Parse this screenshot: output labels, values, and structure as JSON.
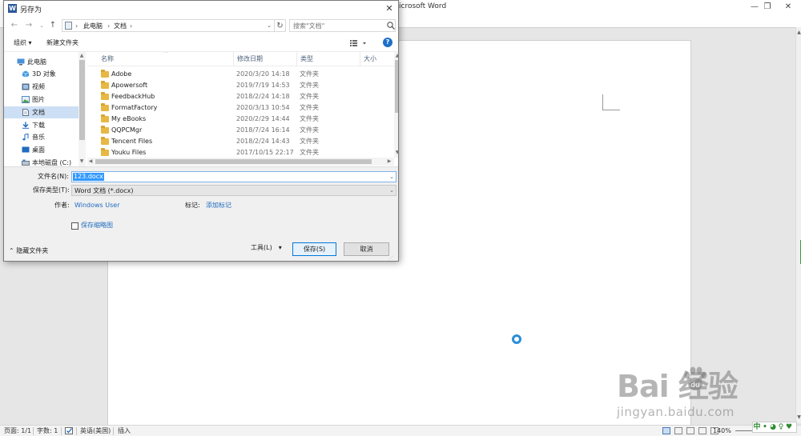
{
  "word": {
    "title": "icrosoft Word",
    "status": {
      "page": "页面: 1/1",
      "words": "字数: 1",
      "language": "英语(美国)",
      "insert_mode": "插入",
      "zoom": "140%"
    },
    "ime": [
      "中",
      "•",
      "◕",
      "♀",
      "♥"
    ]
  },
  "watermark": {
    "logo": "Bai  经验",
    "site": "jingyan.baidu.com"
  },
  "dialog": {
    "title": "另存为",
    "app_icon": "W",
    "breadcrumbs": [
      "此电脑",
      "文档"
    ],
    "search_placeholder": "搜索\"文档\"",
    "toolbar": {
      "organize": "组织 ▾",
      "new_folder": "新建文件夹"
    },
    "nav_items": [
      {
        "label": "此电脑",
        "icon": "pc-icon"
      },
      {
        "label": "3D 对象",
        "icon": "cube-icon"
      },
      {
        "label": "视频",
        "icon": "video-icon"
      },
      {
        "label": "图片",
        "icon": "picture-icon"
      },
      {
        "label": "文档",
        "icon": "document-icon",
        "selected": true
      },
      {
        "label": "下载",
        "icon": "download-icon"
      },
      {
        "label": "音乐",
        "icon": "music-icon"
      },
      {
        "label": "桌面",
        "icon": "desktop-icon"
      },
      {
        "label": "本地磁盘 (C:)",
        "icon": "drive-icon"
      }
    ],
    "columns": {
      "name": "名称",
      "date": "修改日期",
      "type": "类型",
      "size": "大小"
    },
    "files": [
      {
        "name": "Adobe",
        "date": "2020/3/20 14:18",
        "type": "文件夹"
      },
      {
        "name": "Apowersoft",
        "date": "2019/7/19 14:53",
        "type": "文件夹"
      },
      {
        "name": "FeedbackHub",
        "date": "2018/2/24 14:18",
        "type": "文件夹"
      },
      {
        "name": "FormatFactory",
        "date": "2020/3/13 10:54",
        "type": "文件夹"
      },
      {
        "name": "My eBooks",
        "date": "2020/2/29 14:44",
        "type": "文件夹"
      },
      {
        "name": "QQPCMgr",
        "date": "2018/7/24 16:14",
        "type": "文件夹"
      },
      {
        "name": "Tencent Files",
        "date": "2018/2/24 14:43",
        "type": "文件夹"
      },
      {
        "name": "Youku Files",
        "date": "2017/10/15 22:17",
        "type": "文件夹"
      }
    ],
    "form": {
      "filename_label": "文件名(N):",
      "filename_value": "123.docx",
      "filetype_label": "保存类型(T):",
      "filetype_value": "Word 文档 (*.docx)",
      "author_label": "作者:",
      "author_value": "Windows User",
      "tags_label": "标记:",
      "tags_value": "添加标记",
      "thumbnail_label": "保存缩略图",
      "tools_label": "工具(L)",
      "save_label": "保存(S)",
      "cancel_label": "取消",
      "hide_folders_label": "隐藏文件夹"
    }
  }
}
